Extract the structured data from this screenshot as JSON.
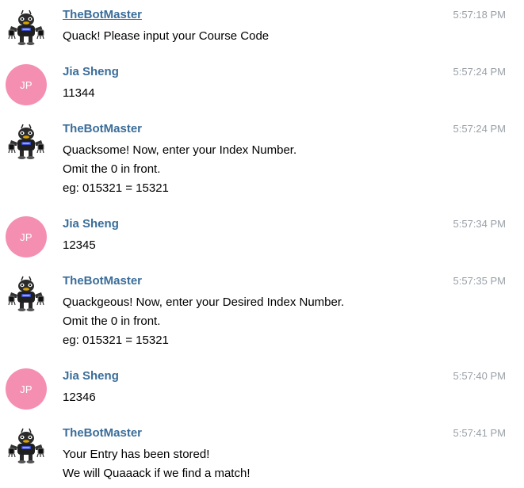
{
  "colors": {
    "sender_name": "#3a6d99",
    "timestamp": "#9aa1a8",
    "user_avatar_bg": "#f48fb1",
    "message_text": "#000000"
  },
  "messages": [
    {
      "sender": "TheBotMaster",
      "avatar": {
        "type": "bot",
        "icon": "robot-duck-icon"
      },
      "time": "5:57:18 PM",
      "lines": [
        "Quack! Please input your Course Code"
      ]
    },
    {
      "sender": "Jia Sheng",
      "avatar": {
        "type": "user",
        "initials": "JP"
      },
      "time": "5:57:24 PM",
      "lines": [
        "11344"
      ]
    },
    {
      "sender": "TheBotMaster",
      "avatar": {
        "type": "bot",
        "icon": "robot-duck-icon"
      },
      "time": "5:57:24 PM",
      "lines": [
        "Quacksome! Now, enter your Index Number.",
        "Omit the 0 in front.",
        "eg: 015321 = 15321"
      ]
    },
    {
      "sender": "Jia Sheng",
      "avatar": {
        "type": "user",
        "initials": "JP"
      },
      "time": "5:57:34 PM",
      "lines": [
        "12345"
      ]
    },
    {
      "sender": "TheBotMaster",
      "avatar": {
        "type": "bot",
        "icon": "robot-duck-icon"
      },
      "time": "5:57:35 PM",
      "lines": [
        "Quackgeous! Now, enter your Desired Index Number.",
        "Omit the 0 in front.",
        "eg: 015321 = 15321"
      ]
    },
    {
      "sender": "Jia Sheng",
      "avatar": {
        "type": "user",
        "initials": "JP"
      },
      "time": "5:57:40 PM",
      "lines": [
        "12346"
      ]
    },
    {
      "sender": "TheBotMaster",
      "avatar": {
        "type": "bot",
        "icon": "robot-duck-icon"
      },
      "time": "5:57:41 PM",
      "lines": [
        "Your Entry has been stored!",
        "We will Quaaack if we find a match!"
      ]
    }
  ]
}
